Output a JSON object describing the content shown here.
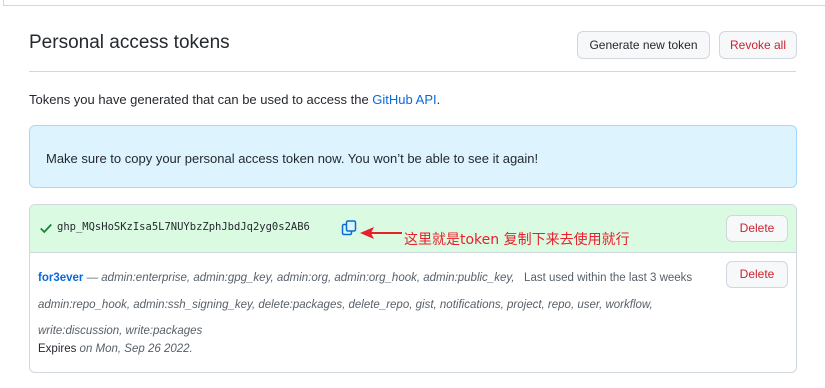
{
  "header": {
    "title": "Personal access tokens",
    "generate_label": "Generate new token",
    "revoke_label": "Revoke all"
  },
  "intro": {
    "text": "Tokens you have generated that can be used to access the ",
    "link": "GitHub API",
    "suffix": "."
  },
  "flash": {
    "text": "Make sure to copy your personal access token now. You won’t be able to see it again!"
  },
  "token": {
    "value": "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",
    "delete_label": "Delete",
    "annotation": "这里就是token  复制下来去使用就行",
    "name": "for3ever",
    "dash": " — ",
    "scopes_line1": "admin:enterprise, admin:gpg_key, admin:org, admin:org_hook, admin:public_key,",
    "last_used": "Last used within the last 3 weeks",
    "scopes_line2": "admin:repo_hook, admin:ssh_signing_key, delete:packages, delete_repo, gist, notifications, project, repo, user, workflow,",
    "scopes_line3": "write:discussion, write:packages",
    "expires_label": "Expires ",
    "expires_date": "on Mon, Sep 26 2022.",
    "delete2_label": "Delete"
  },
  "colors": {
    "link": "#0969da",
    "danger": "#cf222e",
    "success_bg": "#dafbe1",
    "info_bg": "#ddf4ff",
    "annotation": "#e8202a"
  },
  "icons": {
    "check": "check-icon",
    "copy": "copy-icon",
    "arrow": "annotation-arrow"
  }
}
